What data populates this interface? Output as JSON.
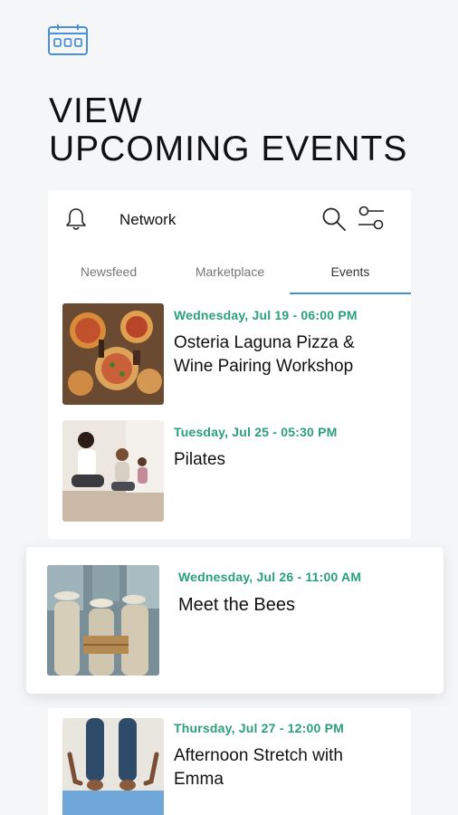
{
  "headline": {
    "line1": "VIEW",
    "line2": "UPCOMING EVENTS"
  },
  "topbar": {
    "title": "Network"
  },
  "tabs": [
    {
      "label": "Newsfeed",
      "active": false
    },
    {
      "label": "Marketplace",
      "active": false
    },
    {
      "label": "Events",
      "active": true
    }
  ],
  "events": [
    {
      "date": "Wednesday, Jul 19 - 06:00 PM",
      "title": "Osteria Laguna Pizza & Wine Pairing Workshop"
    },
    {
      "date": "Tuesday, Jul 25 - 05:30 PM",
      "title": "Pilates"
    },
    {
      "date": "Wednesday, Jul 26 - 11:00 AM",
      "title": "Meet the Bees"
    },
    {
      "date": "Thursday, Jul 27 - 12:00 PM",
      "title": "Afternoon Stretch with Emma"
    }
  ],
  "colors": {
    "accent_green": "#2aa07a",
    "accent_blue": "#4a90d9",
    "background": "#f5f6f8"
  },
  "icons": [
    "calendar-icon",
    "bell-icon",
    "search-icon",
    "filter-icon"
  ]
}
